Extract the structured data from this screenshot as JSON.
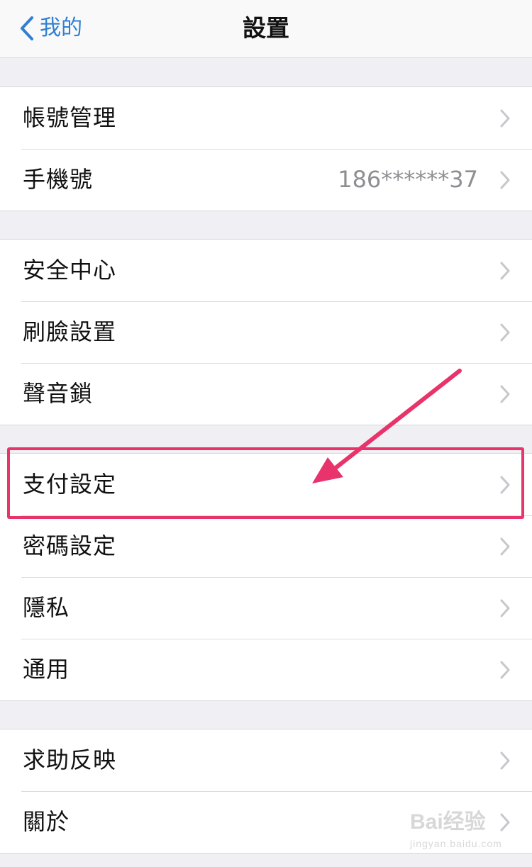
{
  "navbar": {
    "back_label": "我的",
    "title": "設置"
  },
  "groups": [
    {
      "rows": [
        {
          "label": "帳號管理",
          "value": ""
        },
        {
          "label": "手機號",
          "value": "186******37"
        }
      ]
    },
    {
      "rows": [
        {
          "label": "安全中心",
          "value": ""
        },
        {
          "label": "刷臉設置",
          "value": ""
        },
        {
          "label": "聲音鎖",
          "value": ""
        }
      ]
    },
    {
      "rows": [
        {
          "label": "支付設定",
          "value": ""
        },
        {
          "label": "密碼設定",
          "value": ""
        },
        {
          "label": "隱私",
          "value": ""
        },
        {
          "label": "通用",
          "value": ""
        }
      ]
    },
    {
      "rows": [
        {
          "label": "求助反映",
          "value": ""
        },
        {
          "label": "關於",
          "value": ""
        }
      ]
    }
  ],
  "annotation": {
    "highlighted_row": "支付設定",
    "color": "#e8336b"
  },
  "watermark": {
    "main": "Bai经验",
    "sub": "jingyan.baidu.com"
  },
  "colors": {
    "accent": "#2f7fd4",
    "background": "#efeff4",
    "chevron": "#c7c7cc"
  }
}
